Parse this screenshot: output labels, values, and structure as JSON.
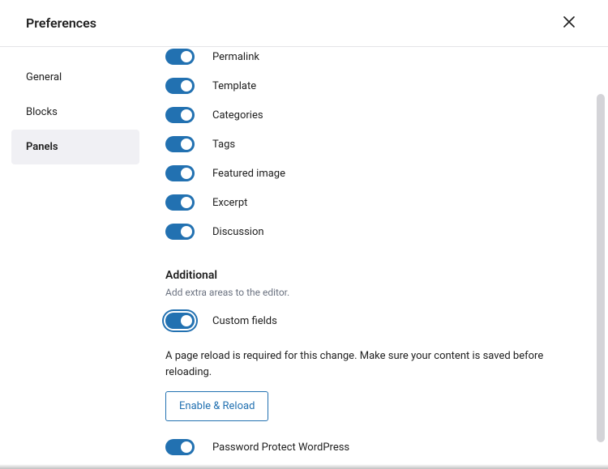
{
  "header": {
    "title": "Preferences"
  },
  "sidebar": {
    "items": [
      {
        "label": "General",
        "active": false
      },
      {
        "label": "Blocks",
        "active": false
      },
      {
        "label": "Panels",
        "active": true
      }
    ]
  },
  "panels": {
    "toggles": [
      {
        "label": "Permalink",
        "on": true,
        "focus": false
      },
      {
        "label": "Template",
        "on": true,
        "focus": false
      },
      {
        "label": "Categories",
        "on": true,
        "focus": false
      },
      {
        "label": "Tags",
        "on": true,
        "focus": false
      },
      {
        "label": "Featured image",
        "on": true,
        "focus": false
      },
      {
        "label": "Excerpt",
        "on": true,
        "focus": false
      },
      {
        "label": "Discussion",
        "on": true,
        "focus": false
      }
    ],
    "additional": {
      "title": "Additional",
      "description": "Add extra areas to the editor.",
      "custom_fields": {
        "label": "Custom fields",
        "on": true,
        "focus": true
      },
      "note": "A page reload is required for this change. Make sure your content is saved before reloading.",
      "reload_button": "Enable & Reload",
      "ppw": {
        "label": "Password Protect WordPress",
        "on": true,
        "focus": false
      }
    }
  }
}
